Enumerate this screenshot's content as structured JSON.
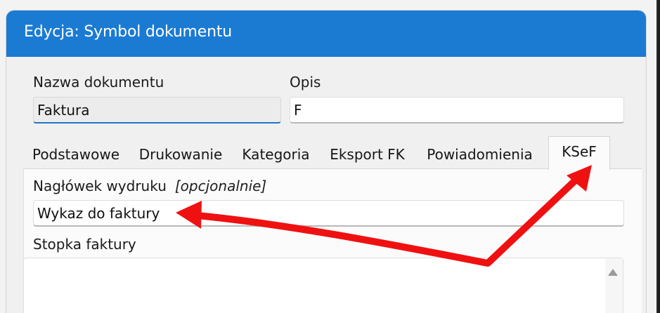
{
  "window": {
    "title": "Edycja: Symbol dokumentu"
  },
  "fields": {
    "document_name_label": "Nazwa dokumentu",
    "document_name_value": "Faktura",
    "description_label": "Opis",
    "description_value": "F"
  },
  "tabs": [
    {
      "label": "Podstawowe",
      "selected": false
    },
    {
      "label": "Drukowanie",
      "selected": false
    },
    {
      "label": "Kategoria",
      "selected": false
    },
    {
      "label": "Eksport FK",
      "selected": false
    },
    {
      "label": "Powiadomienia",
      "selected": false
    },
    {
      "label": "KSeF",
      "selected": true
    }
  ],
  "ksef": {
    "header_label": "Nagłówek wydruku",
    "header_optional": "[opcjonalnie]",
    "header_value": "Wykaz do faktury",
    "footer_label": "Stopka faktury",
    "footer_value": ""
  },
  "icons": {
    "scroll_up": "scroll-up-arrow-icon",
    "annotation": "red-arrow-annotation-icon"
  },
  "colors": {
    "titlebar": "#1b7bd3",
    "focus_underline": "#1f74c8",
    "annotation_arrow": "#ef1111"
  }
}
